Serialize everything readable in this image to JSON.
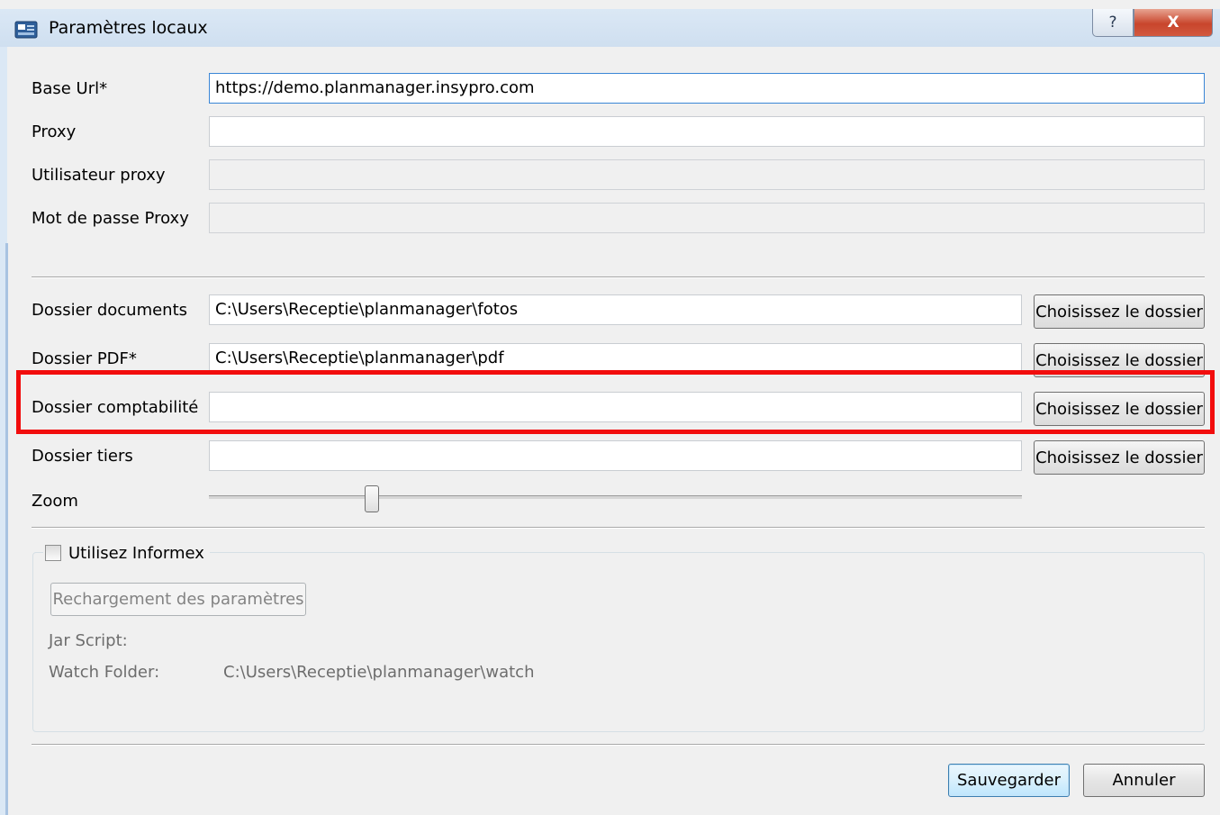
{
  "window": {
    "title": "Paramètres locaux",
    "help_glyph": "?",
    "close_glyph": "X"
  },
  "connection": {
    "base_url_label": "Base Url*",
    "base_url_value": "https://demo.planmanager.insypro.com",
    "proxy_label": "Proxy",
    "proxy_value": "",
    "proxy_user_label": "Utilisateur proxy",
    "proxy_user_value": "",
    "proxy_password_label": "Mot de passe Proxy",
    "proxy_password_value": ""
  },
  "folders": {
    "choose_label": "Choisissez le dossier",
    "documents_label": "Dossier documents",
    "documents_value": "C:\\Users\\Receptie\\planmanager\\fotos",
    "pdf_label": "Dossier PDF*",
    "pdf_value": "C:\\Users\\Receptie\\planmanager\\pdf",
    "accounting_label": "Dossier comptabilité",
    "accounting_value": "",
    "third_party_label": "Dossier tiers",
    "third_party_value": ""
  },
  "zoom": {
    "label": "Zoom",
    "level": 0.2
  },
  "informex": {
    "checkbox_label": "Utilisez Informex",
    "checked": false,
    "reload_button": "Rechargement des paramètres",
    "jar_script_label": "Jar Script:",
    "jar_script_value": "",
    "watch_folder_label": "Watch Folder:",
    "watch_folder_value": "C:\\Users\\Receptie\\planmanager\\watch"
  },
  "footer": {
    "save_label": "Sauvegarder",
    "cancel_label": "Annuler"
  },
  "colors": {
    "highlight": "#f20d0d",
    "titlebar": "#dbe8f5",
    "close_button": "#c8452c"
  },
  "icons": {
    "app": "settings-window-icon",
    "help": "help-icon",
    "close": "close-icon"
  }
}
